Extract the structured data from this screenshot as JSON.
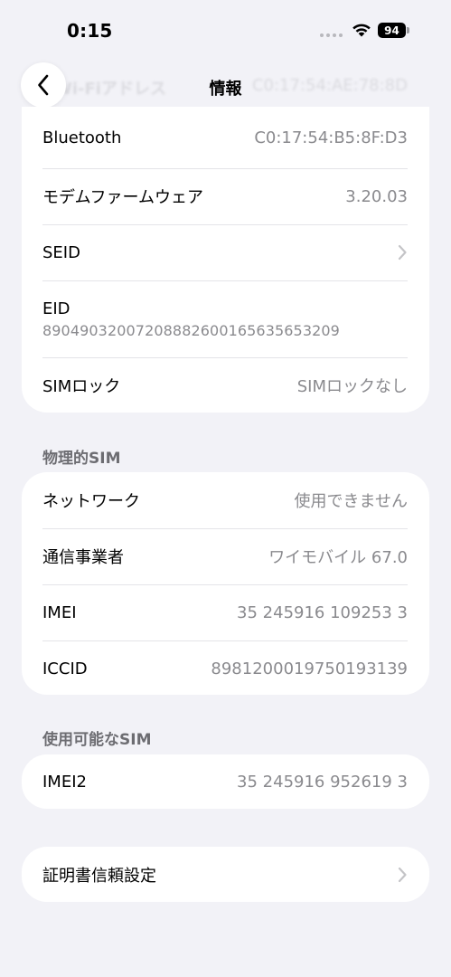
{
  "status_bar": {
    "time": "0:15",
    "battery": "94"
  },
  "faded_row": {
    "label": "Wi-Fiアドレス",
    "value": "C0:17:54:AE:78:8D"
  },
  "nav": {
    "title": "情報"
  },
  "group_top": {
    "rows": [
      {
        "label": "Bluetooth",
        "value": "C0:17:54:B5:8F:D3"
      },
      {
        "label": "モデムファームウェア",
        "value": "3.20.03"
      },
      {
        "label": "SEID"
      },
      {
        "label": "EID",
        "value": "89049032007208882600165635653209"
      },
      {
        "label": "SIMロック",
        "value": "SIMロックなし"
      }
    ]
  },
  "physical_sim": {
    "header": "物理的SIM",
    "rows": [
      {
        "label": "ネットワーク",
        "value": "使用できません"
      },
      {
        "label": "通信事業者",
        "value": "ワイモバイル 67.0"
      },
      {
        "label": "IMEI",
        "value": "35 245916 109253 3"
      },
      {
        "label": "ICCID",
        "value": "8981200019750193139"
      }
    ]
  },
  "available_sim": {
    "header": "使用可能なSIM",
    "rows": [
      {
        "label": "IMEI2",
        "value": "35 245916 952619 3"
      }
    ]
  },
  "certificate": {
    "label": "証明書信頼設定"
  },
  "icons": {
    "back": "chevron-left-icon",
    "disclosure": "chevron-right-icon",
    "wifi": "wifi-icon",
    "battery": "battery-icon"
  },
  "colors": {
    "background": "#f2f2f7",
    "card": "#ffffff",
    "secondary_text": "#8a8a8e"
  }
}
